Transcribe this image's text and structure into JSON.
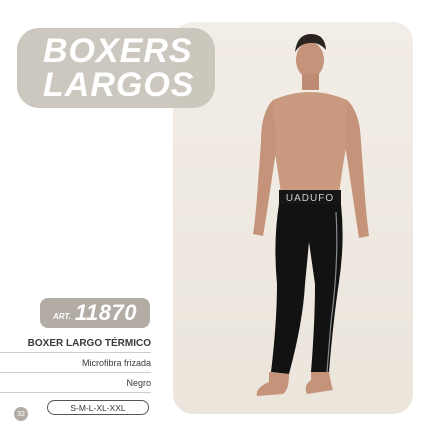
{
  "title": {
    "line1": "BOXERS",
    "line2": "LARGOS"
  },
  "article": {
    "label": "ART.",
    "number": "11870"
  },
  "product": {
    "name": "BOXER LARGO TÉRMICO",
    "material": "Microfibra frizada",
    "color": "Negro",
    "sizes": "S-M-L-XL-XXL"
  },
  "page_number": "32",
  "waistband_text": "UADUFO",
  "colors": {
    "pill_gray": "#c8c3ba",
    "art_gray": "#b3aca4",
    "photo_bg": "#efe9e1",
    "garment": "#121212"
  }
}
